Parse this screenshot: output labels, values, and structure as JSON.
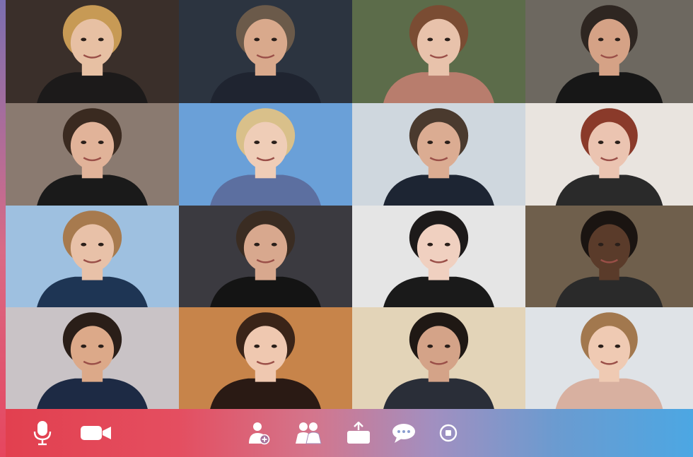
{
  "colors": {
    "toolbar_start": "#e2404f",
    "toolbar_mid": "#a28fc0",
    "toolbar_end": "#4ca7e3",
    "icon_color": "#ffffff",
    "left_edge": "#d96a86"
  },
  "participants": [
    {
      "row": 1,
      "col": 1,
      "bg": "#3a2f2a",
      "hair": "#c79a55",
      "skin": "#e7c0a3",
      "shirt": "#1c1a1a"
    },
    {
      "row": 1,
      "col": 2,
      "bg": "#2c3440",
      "hair": "#6b5a4a",
      "skin": "#d9a98c",
      "shirt": "#1f2430"
    },
    {
      "row": 1,
      "col": 3,
      "bg": "#5c6c4a",
      "hair": "#7a4c33",
      "skin": "#e8c2ab",
      "shirt": "#b87d6d"
    },
    {
      "row": 1,
      "col": 4,
      "bg": "#6d6860",
      "hair": "#2e2621",
      "skin": "#d5a286",
      "shirt": "#171717"
    },
    {
      "row": 2,
      "col": 1,
      "bg": "#8a7a70",
      "hair": "#3a2a20",
      "skin": "#e1b399",
      "shirt": "#1a1a1a"
    },
    {
      "row": 2,
      "col": 2,
      "bg": "#6aa0d8",
      "hair": "#d9c08a",
      "skin": "#efcdb7",
      "shirt": "#5c6fa0"
    },
    {
      "row": 2,
      "col": 3,
      "bg": "#cfd7de",
      "hair": "#4a3a2e",
      "skin": "#dbac92",
      "shirt": "#1d2533"
    },
    {
      "row": 2,
      "col": 4,
      "bg": "#e9e4df",
      "hair": "#8a3a2a",
      "skin": "#ebc4b1",
      "shirt": "#2a2a2a"
    },
    {
      "row": 3,
      "col": 1,
      "bg": "#9ec0e0",
      "hair": "#a77a4e",
      "skin": "#e8c1a8",
      "shirt": "#1e3554"
    },
    {
      "row": 3,
      "col": 2,
      "bg": "#3b3a40",
      "hair": "#3a2c22",
      "skin": "#d8a88e",
      "shirt": "#141414"
    },
    {
      "row": 3,
      "col": 3,
      "bg": "#e5e5e5",
      "hair": "#1d1a1a",
      "skin": "#f0d0c0",
      "shirt": "#1a1a1a"
    },
    {
      "row": 3,
      "col": 4,
      "bg": "#6f5f4c",
      "hair": "#1a1411",
      "skin": "#5a3b2a",
      "shirt": "#2a2a2a"
    },
    {
      "row": 4,
      "col": 1,
      "bg": "#c9c3c6",
      "hair": "#2a1e18",
      "skin": "#dca989",
      "shirt": "#1d2a44"
    },
    {
      "row": 4,
      "col": 2,
      "bg": "#c7844a",
      "hair": "#3a2418",
      "skin": "#efc8b0",
      "shirt": "#2a1a14"
    },
    {
      "row": 4,
      "col": 3,
      "bg": "#e3d4b8",
      "hair": "#1f1814",
      "skin": "#d4a388",
      "shirt": "#2a2e38"
    },
    {
      "row": 4,
      "col": 4,
      "bg": "#dfe3e7",
      "hair": "#a2784e",
      "skin": "#efcab3",
      "shirt": "#d8b0a0"
    }
  ],
  "toolbar": {
    "buttons": [
      {
        "name": "microphone-button",
        "icon": "microphone-icon"
      },
      {
        "name": "camera-button",
        "icon": "video-camera-icon"
      },
      {
        "name": "invite-participant-button",
        "icon": "add-user-icon"
      },
      {
        "name": "participants-button",
        "icon": "participants-icon"
      },
      {
        "name": "share-screen-button",
        "icon": "share-screen-icon"
      },
      {
        "name": "chat-button",
        "icon": "chat-icon"
      },
      {
        "name": "record-button",
        "icon": "record-icon"
      }
    ]
  }
}
